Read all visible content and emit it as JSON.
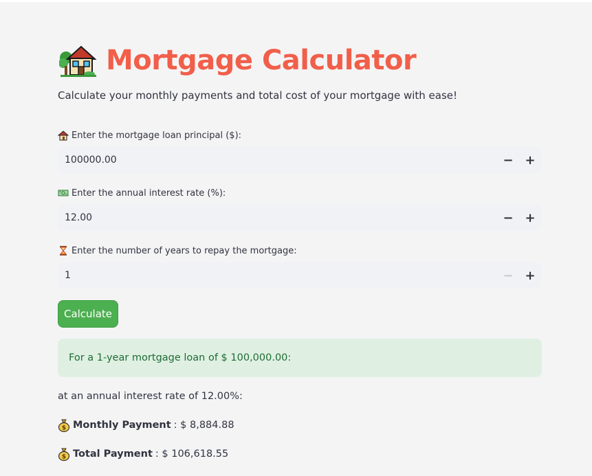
{
  "app": {
    "title": "Mortgage Calculator",
    "subtitle": "Calculate your monthly payments and total cost of your mortgage with ease!",
    "title_icon": "house-with-garden-icon",
    "accent_color": "#f15f4a"
  },
  "fields": [
    {
      "icon": "house-icon",
      "label": "Enter the mortgage loan principal ($):",
      "value": "100000.00",
      "minus_enabled": true
    },
    {
      "icon": "money-icon",
      "label": "Enter the annual interest rate (%):",
      "value": "12.00",
      "minus_enabled": true
    },
    {
      "icon": "hourglass-icon",
      "label": "Enter the number of years to repay the mortgage:",
      "value": "1",
      "minus_enabled": false
    }
  ],
  "controls": {
    "minus": "−",
    "plus": "+"
  },
  "calculate_button": {
    "label": "Calculate",
    "color": "#4caf50"
  },
  "results": {
    "success_text": "For a 1-year mortgage loan of $ 100,000.00:",
    "rate_text": "at an annual interest rate of 12.00%:",
    "monthly_label": "Monthly Payment",
    "monthly_value": ": $ 8,884.88",
    "total_label": "Total Payment",
    "total_value": ": $ 106,618.55",
    "icon": "money-bag-icon"
  }
}
